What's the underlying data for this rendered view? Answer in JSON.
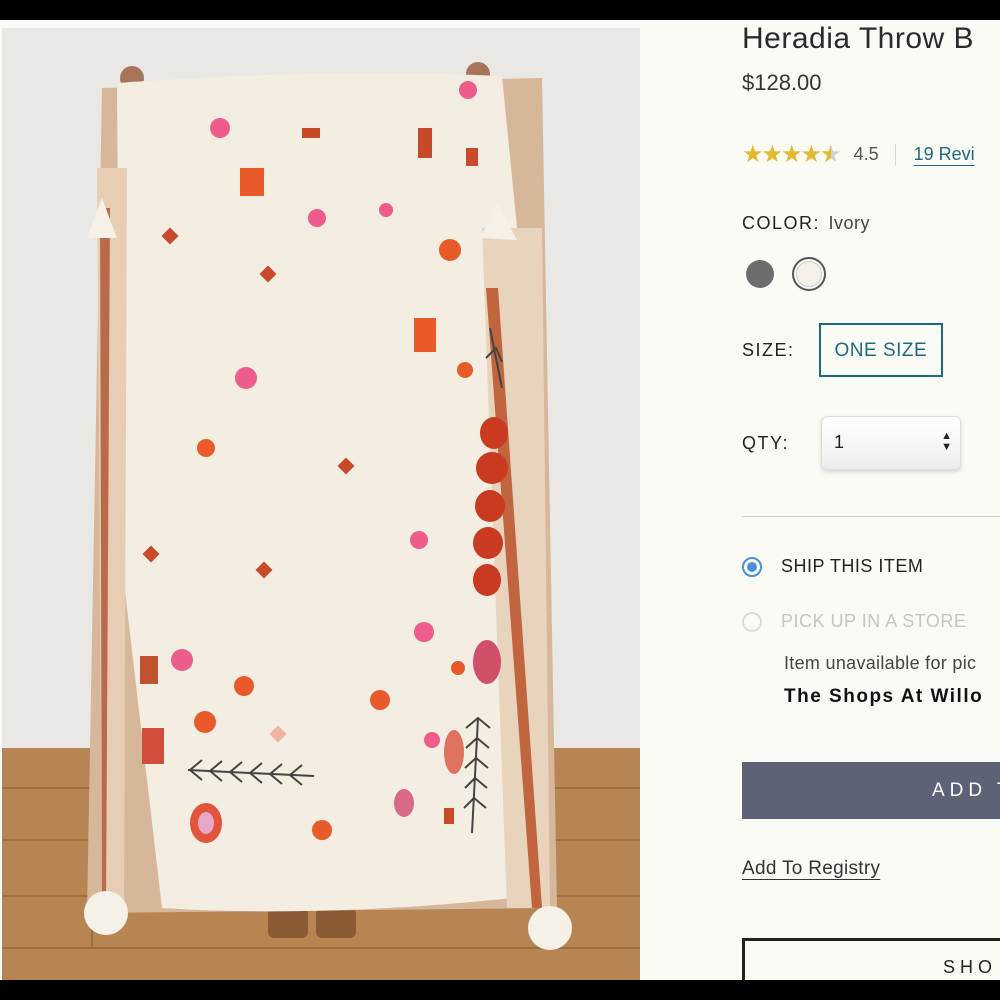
{
  "product": {
    "title": "Heradia Throw B",
    "price": "$128.00",
    "image_alt": "Person holding up an ivory woven throw blanket with pink and orange tufted motifs and tassels"
  },
  "rating": {
    "value": "4.5",
    "stars_filled_fraction": 0.9,
    "reviews_link": "19 Revi"
  },
  "color": {
    "label": "COLOR:",
    "value": "Ivory",
    "swatches": [
      {
        "name": "gray",
        "hex": "#6d6d6d",
        "selected": false
      },
      {
        "name": "ivory",
        "hex": "#f5f0e8",
        "selected": true
      }
    ]
  },
  "size": {
    "label": "SIZE:",
    "option": "ONE SIZE"
  },
  "qty": {
    "label": "QTY:",
    "value": "1"
  },
  "fulfillment": {
    "ship_label": "SHIP THIS ITEM",
    "pickup_label": "PICK UP IN A STORE",
    "unavailable_text": "Item unavailable for pic",
    "store_name": "The Shops At Willo"
  },
  "actions": {
    "add_label": "ADD T",
    "registry_label": "Add To Registry",
    "shop_label": "SHO"
  },
  "colors": {
    "accent": "#1d6a82",
    "radio": "#4a90d9",
    "star": "#e4b92c",
    "button": "#5d6277"
  }
}
